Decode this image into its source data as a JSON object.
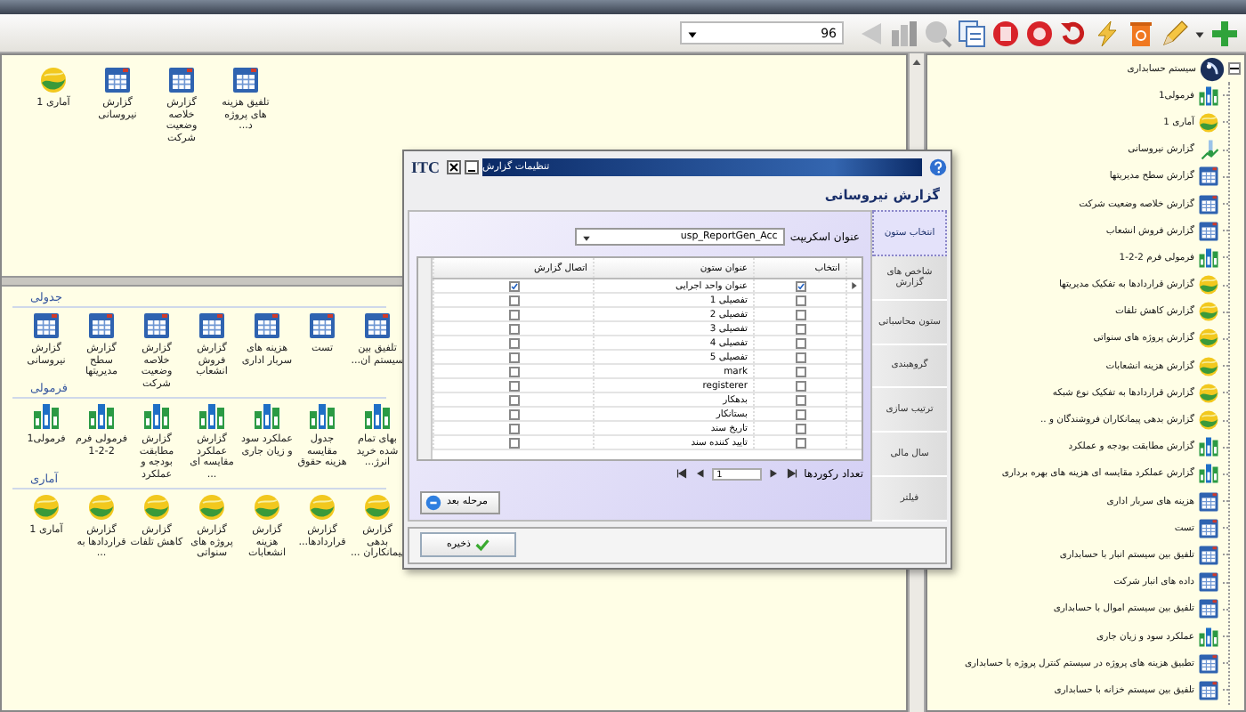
{
  "toolbar": {
    "zoom_value": "96"
  },
  "gallery": {
    "top_items": [
      {
        "label": "تلفیق هزینه های پروژه د...",
        "kind": "table"
      },
      {
        "label": "گزارش خلاصه وضعیت شرکت",
        "kind": "table"
      },
      {
        "label": "گزارش نیروسانی",
        "kind": "table"
      },
      {
        "label": "آماری 1",
        "kind": "stat"
      }
    ],
    "groups": [
      {
        "title": "جدولی",
        "items": [
          {
            "label": "تلفیق بین سیستم ان...",
            "kind": "table"
          },
          {
            "label": "تست",
            "kind": "table"
          },
          {
            "label": "هزینه های سربار اداری",
            "kind": "table"
          },
          {
            "label": "گزارش فروش انشعاب",
            "kind": "table"
          },
          {
            "label": "گزارش خلاصه وضعیت شرکت",
            "kind": "table"
          },
          {
            "label": "گزارش سطح مدیریتها",
            "kind": "table"
          },
          {
            "label": "گزارش نیروسانی",
            "kind": "table"
          }
        ]
      },
      {
        "title": "فرمولی",
        "items": [
          {
            "label": "بهای تمام شده خرید انرژ...",
            "kind": "formula"
          },
          {
            "label": "جدول مقایسه هزینه حقوق",
            "kind": "formula"
          },
          {
            "label": "عملکرد سود و زیان جاری",
            "kind": "formula"
          },
          {
            "label": "گزارش عملکرد مقایسه ای ...",
            "kind": "formula"
          },
          {
            "label": "گزارش مطابقت بودجه و عملکرد",
            "kind": "formula"
          },
          {
            "label": "فرمولی فرم 2-2-1",
            "kind": "formula"
          },
          {
            "label": "فرمولی1",
            "kind": "formula"
          }
        ]
      },
      {
        "title": "آماری",
        "items": [
          {
            "label": "گزارش بدهی پیمانکاران ...",
            "kind": "stat"
          },
          {
            "label": "گزارش قراردادها...",
            "kind": "stat"
          },
          {
            "label": "گزارش هزینه انشعابات",
            "kind": "stat"
          },
          {
            "label": "گزارش پروژه های سنواتی",
            "kind": "stat"
          },
          {
            "label": "گزارش کاهش تلفات",
            "kind": "stat"
          },
          {
            "label": "گزارش قراردادها به ...",
            "kind": "stat"
          },
          {
            "label": "آماری 1",
            "kind": "stat"
          }
        ]
      }
    ]
  },
  "tree": {
    "label": "سیستم حسابداری",
    "expanded": true,
    "children": [
      {
        "label": "فرمولی1",
        "kind": "formula"
      },
      {
        "label": "آماری 1",
        "kind": "stat"
      },
      {
        "label": "گزارش نیروسانی",
        "kind": "misc"
      },
      {
        "label": "گزارش سطح مدیریتها",
        "kind": "table"
      },
      {
        "label": "گزارش خلاصه وضعیت شرکت",
        "kind": "table"
      },
      {
        "label": "گزارش فروش انشعاب",
        "kind": "table"
      },
      {
        "label": "فرمولی فرم 2-2-1",
        "kind": "formula"
      },
      {
        "label": "گزارش قراردادها به تفکیک مدیریتها",
        "kind": "stat"
      },
      {
        "label": "گزارش کاهش تلفات",
        "kind": "stat"
      },
      {
        "label": "گزارش پروژه های سنواتی",
        "kind": "stat"
      },
      {
        "label": "گزارش هزینه انشعابات",
        "kind": "stat"
      },
      {
        "label": "گزارش قراردادها به تفکیک نوع شبکه",
        "kind": "stat"
      },
      {
        "label": "گزارش بدهی پیمانکاران فروشندگان و ..",
        "kind": "stat"
      },
      {
        "label": "گزارش مطابقت بودجه و عملکرد",
        "kind": "formula"
      },
      {
        "label": "گزارش عملکرد مقایسه ای هزینه های بهره برداری",
        "kind": "formula"
      },
      {
        "label": "هزینه های سربار اداری",
        "kind": "table"
      },
      {
        "label": "تست",
        "kind": "table"
      },
      {
        "label": "تلفیق بین سیستم انبار با حسابداری",
        "kind": "table"
      },
      {
        "label": "داده های انبار شرکت",
        "kind": "table"
      },
      {
        "label": "تلفیق بین سیستم اموال با حسابداری",
        "kind": "table"
      },
      {
        "label": "عملکرد سود و زیان جاری",
        "kind": "formula"
      },
      {
        "label": "تطبیق هزینه های پروژه در سیستم کنترل پروژه با حسابداری",
        "kind": "table"
      },
      {
        "label": "تلفیق بین سیستم خزانه با حسابداری",
        "kind": "table"
      }
    ]
  },
  "dialog": {
    "logo": "ITC",
    "title": "تنظیمات گزارش",
    "heading": "گزارش نیروسانی",
    "tabs": [
      {
        "label": "انتخاب ستون",
        "selected": true
      },
      {
        "label": "شاخص های گزارش",
        "selected": false
      },
      {
        "label": "ستون محاسباتی",
        "selected": false
      },
      {
        "label": "گروهبندی",
        "selected": false
      },
      {
        "label": "ترتیب سازی",
        "selected": false
      },
      {
        "label": "سال مالی",
        "selected": false
      },
      {
        "label": "فیلتر",
        "selected": false
      }
    ],
    "script_label": "عنوان اسکریپت",
    "script_value": "usp_ReportGen_Acc",
    "columns": [
      "انتخاب",
      "عنوان ستون",
      "اتصال گزارش"
    ],
    "rows": [
      {
        "title": "عنوان واحد اجرایی",
        "checked": true,
        "linked": true,
        "selected": true
      },
      {
        "title": "تفصیلی 1",
        "checked": false,
        "linked": false,
        "selected": false
      },
      {
        "title": "تفصیلی 2",
        "checked": false,
        "linked": false,
        "selected": false
      },
      {
        "title": "تفصیلی 3",
        "checked": false,
        "linked": false,
        "selected": false
      },
      {
        "title": "تفصیلی 4",
        "checked": false,
        "linked": false,
        "selected": false
      },
      {
        "title": "تفصیلی 5",
        "checked": false,
        "linked": false,
        "selected": false
      },
      {
        "title": "mark",
        "checked": false,
        "linked": false,
        "selected": false
      },
      {
        "title": "registerer",
        "checked": false,
        "linked": false,
        "selected": false
      },
      {
        "title": "بدهکار",
        "checked": false,
        "linked": false,
        "selected": false
      },
      {
        "title": "بستانکار",
        "checked": false,
        "linked": false,
        "selected": false
      },
      {
        "title": "تاریخ سند",
        "checked": false,
        "linked": false,
        "selected": false
      },
      {
        "title": "تایید کننده سند",
        "checked": false,
        "linked": false,
        "selected": false
      }
    ],
    "pager": {
      "label": "تعداد رکوردها",
      "page": "1"
    },
    "next_button": "مرحله بعد",
    "save_button": "ذخیره"
  }
}
